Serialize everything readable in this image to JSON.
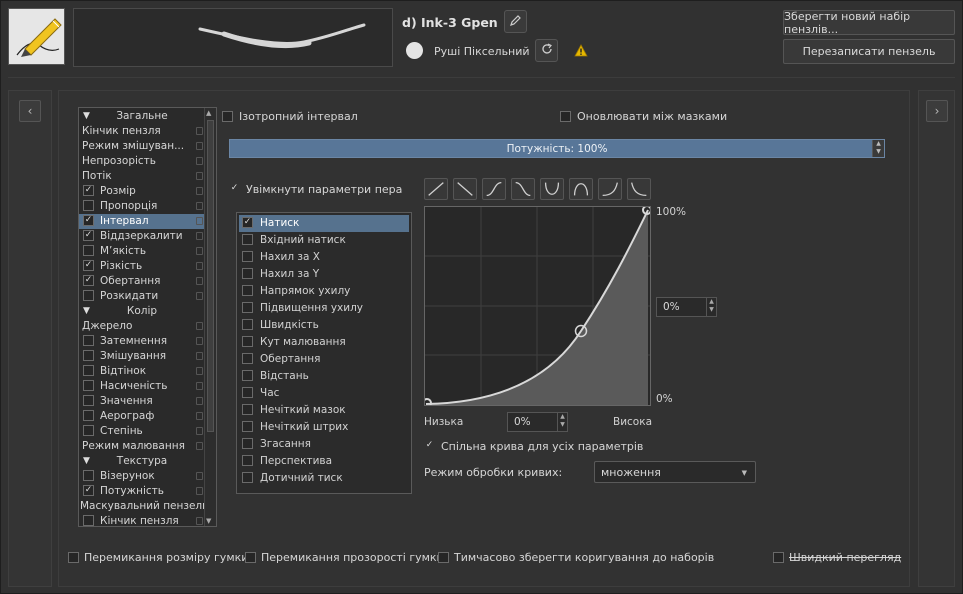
{
  "header": {
    "preset_name": "d) Ink-3 Gpen",
    "engine_label": "Руші Піксельний",
    "save_new_label": "Зберегти новий набір пензлів...",
    "overwrite_label": "Перезаписати пензель"
  },
  "nav": {
    "prev_icon": "chevron-left-icon",
    "next_icon": "chevron-right-icon"
  },
  "options": [
    {
      "type": "cat",
      "label": "Загальне"
    },
    {
      "type": "item",
      "label": "Кінчик пензля"
    },
    {
      "type": "item",
      "label": "Режим змішуван..."
    },
    {
      "type": "item",
      "label": "Непрозорість"
    },
    {
      "type": "item",
      "label": "Потік"
    },
    {
      "type": "check",
      "label": "Розмір",
      "checked": true
    },
    {
      "type": "check",
      "label": "Пропорція",
      "checked": false
    },
    {
      "type": "check",
      "label": "Інтервал",
      "checked": true,
      "selected": true
    },
    {
      "type": "check",
      "label": "Віддзеркалити",
      "checked": true
    },
    {
      "type": "check",
      "label": "М’якість",
      "checked": false
    },
    {
      "type": "check",
      "label": "Різкість",
      "checked": true
    },
    {
      "type": "check",
      "label": "Обертання",
      "checked": true
    },
    {
      "type": "check",
      "label": "Розкидати",
      "checked": false
    },
    {
      "type": "cat",
      "label": "Колір"
    },
    {
      "type": "item",
      "label": "Джерело"
    },
    {
      "type": "check",
      "label": "Затемнення",
      "checked": false
    },
    {
      "type": "check",
      "label": "Змішування",
      "checked": false
    },
    {
      "type": "check",
      "label": "Відтінок",
      "checked": false
    },
    {
      "type": "check",
      "label": "Насиченість",
      "checked": false
    },
    {
      "type": "check",
      "label": "Значення",
      "checked": false
    },
    {
      "type": "check",
      "label": "Аерограф",
      "checked": false
    },
    {
      "type": "check",
      "label": "Степінь",
      "checked": false
    },
    {
      "type": "item",
      "label": "Режим малювання"
    },
    {
      "type": "cat",
      "label": "Текстура"
    },
    {
      "type": "check",
      "label": "Візерунок",
      "checked": false
    },
    {
      "type": "check",
      "label": "Потужність",
      "checked": true
    },
    {
      "type": "cat2",
      "label": "Маскувальний пензель"
    },
    {
      "type": "check",
      "label": "Кінчик пензля",
      "checked": false
    }
  ],
  "settings": {
    "isotropic_label": "Ізотропний інтервал",
    "update_masks_label": "Оновлювати між мазками",
    "strength_label": "Потужність: 100%",
    "strength_value": 100,
    "enable_pen_label": "Увімкнути параметри пера"
  },
  "sensors": [
    {
      "label": "Натиск",
      "checked": true,
      "selected": true
    },
    {
      "label": "Вхідний натиск",
      "checked": false
    },
    {
      "label": "Нахил за X",
      "checked": false
    },
    {
      "label": "Нахил за Y",
      "checked": false
    },
    {
      "label": "Напрямок ухилу",
      "checked": false
    },
    {
      "label": "Підвищення ухилу",
      "checked": false
    },
    {
      "label": "Швидкість",
      "checked": false
    },
    {
      "label": "Кут малювання",
      "checked": false
    },
    {
      "label": "Обертання",
      "checked": false
    },
    {
      "label": "Відстань",
      "checked": false
    },
    {
      "label": "Час",
      "checked": false
    },
    {
      "label": "Нечіткий мазок",
      "checked": false
    },
    {
      "label": "Нечіткий штрих",
      "checked": false
    },
    {
      "label": "Згасання",
      "checked": false
    },
    {
      "label": "Перспектива",
      "checked": false
    },
    {
      "label": "Дотичний тиск",
      "checked": false
    }
  ],
  "curve": {
    "max_label": "100%",
    "min_label": "0%",
    "point_value": "0%",
    "low_label": "Низька",
    "low_value": "0%",
    "high_label": "Висока",
    "shared_curve_label": "Спільна крива для усіх параметрів",
    "mode_label": "Режим обробки кривих:",
    "mode_value": "множення",
    "presets": [
      "linear-up-icon",
      "linear-down-icon",
      "s-curve-icon",
      "reverse-s-curve-icon",
      "u-curve-icon",
      "arch-curve-icon",
      "j-curve-icon",
      "reverse-j-curve-icon"
    ]
  },
  "bottom": {
    "eraser_size": "Перемикання розміру гумки",
    "eraser_opacity": "Перемикання прозорості гумки",
    "temp_save": "Тимчасово зберегти коригування до наборів",
    "instant_preview": "Швидкий перегляд"
  }
}
